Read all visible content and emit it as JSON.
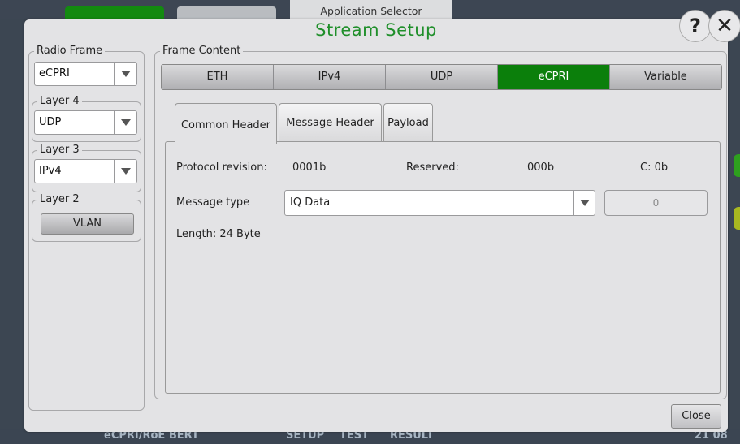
{
  "window": {
    "title": "Stream Setup",
    "app_tab": "Application Selector"
  },
  "left_panel": {
    "radio_frame": {
      "label": "Radio Frame",
      "value": "eCPRI"
    },
    "layer4": {
      "label": "Layer 4",
      "value": "UDP"
    },
    "layer3": {
      "label": "Layer 3",
      "value": "IPv4"
    },
    "layer2": {
      "label": "Layer 2",
      "button": "VLAN"
    }
  },
  "frame_content": {
    "label": "Frame Content",
    "protocol_tabs": [
      "ETH",
      "IPv4",
      "UDP",
      "eCPRI",
      "Variable"
    ],
    "active_protocol": "eCPRI",
    "header_tabs": [
      "Common Header",
      "Message Header",
      "Payload"
    ],
    "active_header_tab": "Common Header",
    "fields": {
      "protocol_revision_label": "Protocol revision:",
      "protocol_revision_value": "0001b",
      "reserved_label": "Reserved:",
      "reserved_value": "000b",
      "c_value": "C: 0b",
      "message_type_label": "Message type",
      "message_type_value": "IQ Data",
      "message_type_number": "0",
      "length_text": "Length: 24 Byte"
    }
  },
  "buttons": {
    "close": "Close",
    "help": "?",
    "close_x": "✕"
  },
  "taskbar": {
    "app_name": "eCPRI/RoE BERT",
    "setup": "SETUP",
    "test": "TEST",
    "result": "RESULT",
    "time": "21 08"
  },
  "colors": {
    "accent_green": "#0b7f0b",
    "title_green": "#1f8f2a"
  }
}
